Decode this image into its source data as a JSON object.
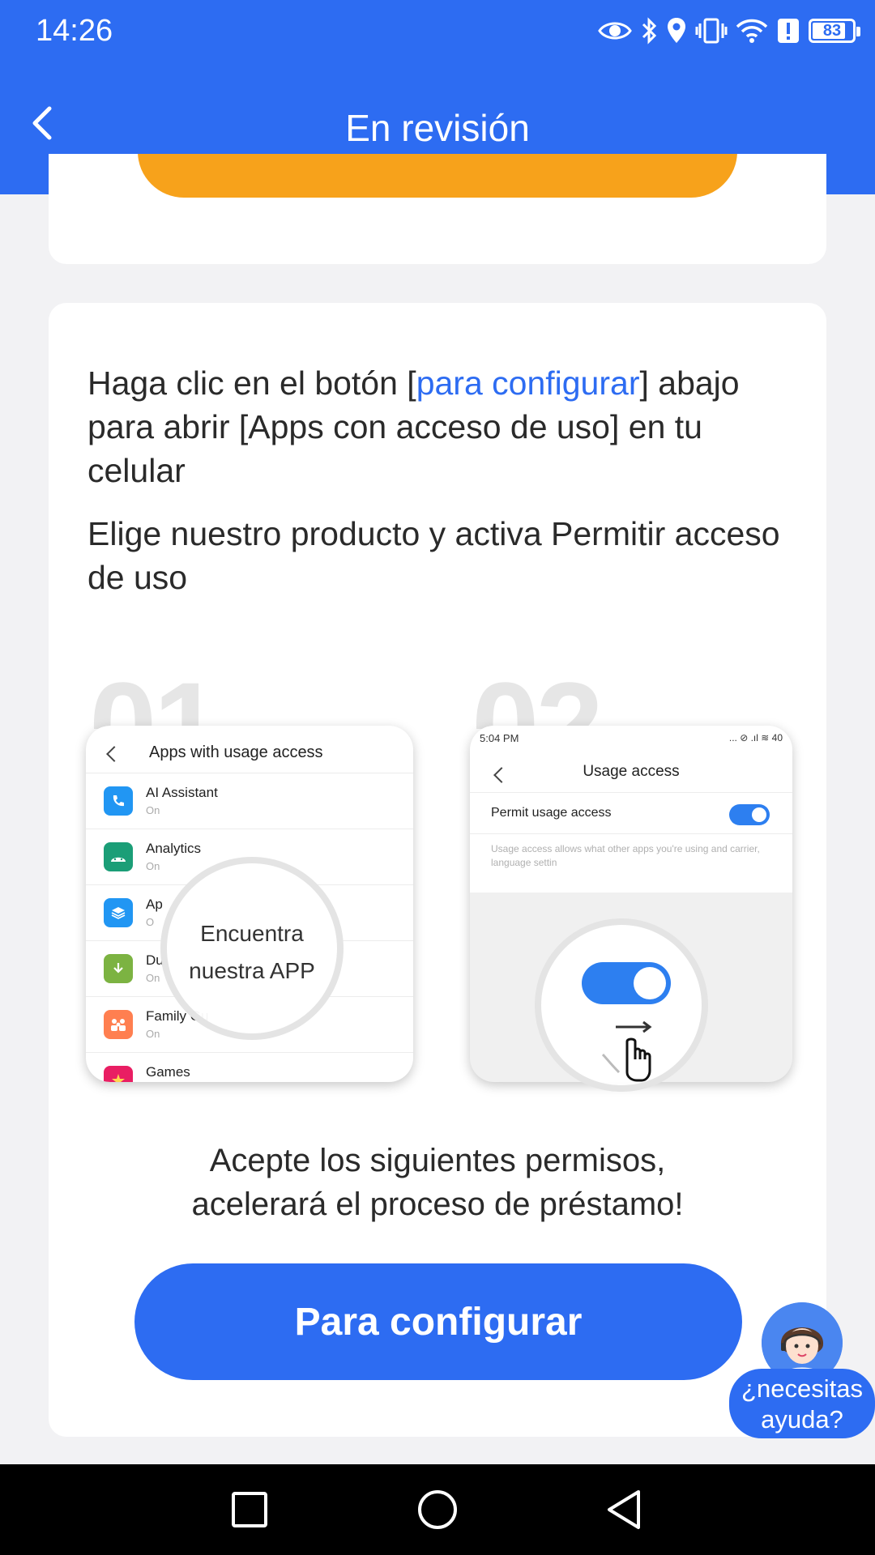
{
  "status_bar": {
    "time": "14:26",
    "battery": "83",
    "icons": [
      "eye-icon",
      "bluetooth-icon",
      "location-icon",
      "vibrate-icon",
      "wifi-icon",
      "alert-icon",
      "battery-icon"
    ]
  },
  "header": {
    "title": "En revisión",
    "back_icon": "chevron-left-icon"
  },
  "instructions": {
    "line1_before": "Haga clic en el botón [",
    "line1_link": "para configurar",
    "line1_after": "] abajo para abrir [Apps con acceso de uso] en tu celular",
    "line2": "Elige nuestro producto y activa Permitir acceso de uso"
  },
  "illustration": {
    "step1_number": "01",
    "step2_number": "02",
    "phone1": {
      "title": "Apps with usage access",
      "apps": [
        {
          "name": "AI Assistant",
          "status": "On",
          "color": "#2196f3"
        },
        {
          "name": "Analytics",
          "status": "On",
          "color": "#1b9e77"
        },
        {
          "name": "Ap",
          "status": "O",
          "color": "#2196f3"
        },
        {
          "name": "Du",
          "status": "On",
          "color": "#7cb342"
        },
        {
          "name": "Family Gu",
          "status": "On",
          "color": "#ff7f50"
        },
        {
          "name": "Games",
          "status": "",
          "color": "#e91e63"
        }
      ],
      "magnifier_text_1": "Encuentra",
      "magnifier_text_2": "nuestra APP"
    },
    "phone2": {
      "time": "5:04 PM",
      "status_icons": "... ⊘ .ıl ≋ 40",
      "title": "Usage access",
      "row_label": "Permit usage access",
      "description": "Usage access allows          what other apps you're using and          carrier, language settin"
    }
  },
  "accept": {
    "line1": "Acepte los siguientes permisos,",
    "line2": "acelerará el proceso de préstamo!"
  },
  "primary_button": "Para configurar",
  "help": {
    "line1": "¿necesitas",
    "line2": "ayuda?"
  },
  "colors": {
    "brand_blue": "#2d6cf2",
    "orange": "#f7a21b",
    "background": "#f2f2f4"
  }
}
